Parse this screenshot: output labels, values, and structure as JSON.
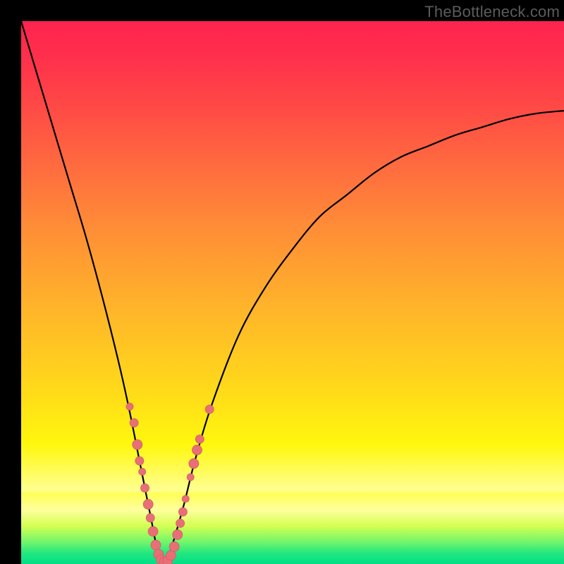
{
  "watermark": "TheBottleneck.com",
  "colors": {
    "background": "#000000",
    "curve": "#000000",
    "marker_fill": "#e96f77",
    "marker_stroke": "#cf5c66",
    "gradient_stops": [
      "#ff234f",
      "#ff2e4c",
      "#ff4746",
      "#ff6c3f",
      "#ff8a37",
      "#ffb22b",
      "#ffda1a",
      "#fff70d",
      "#ffff93",
      "#ffff56",
      "#ffff9e",
      "#d4ff52",
      "#70f56c",
      "#23e77f",
      "#00df86"
    ]
  },
  "chart_data": {
    "type": "line",
    "title": "",
    "xlabel": "",
    "ylabel": "",
    "xlim": [
      0,
      100
    ],
    "ylim": [
      0,
      100
    ],
    "note": "Axes are implicit. x≈component index (0–100), y≈bottleneck % (0 good / 100 bad). Curve has a sharp minimum near x≈26 where y≈0.",
    "series": [
      {
        "name": "bottleneck-curve",
        "x": [
          0,
          3,
          6,
          9,
          12,
          15,
          18,
          20,
          22,
          24,
          25,
          26,
          27,
          28,
          30,
          32,
          35,
          40,
          45,
          50,
          55,
          60,
          65,
          70,
          75,
          80,
          85,
          90,
          95,
          100
        ],
        "y": [
          100,
          90,
          80,
          70,
          60,
          49,
          37,
          28,
          18,
          8,
          3,
          0,
          1,
          4,
          11,
          19,
          29,
          42,
          51,
          58,
          64,
          68,
          72,
          75,
          77,
          79,
          80.5,
          82,
          83,
          83.5
        ]
      }
    ],
    "markers": {
      "name": "highlighted-points",
      "points": [
        {
          "x": 20.0,
          "y": 29,
          "r": 5
        },
        {
          "x": 20.8,
          "y": 26,
          "r": 6
        },
        {
          "x": 21.4,
          "y": 22,
          "r": 7
        },
        {
          "x": 21.8,
          "y": 19,
          "r": 6
        },
        {
          "x": 22.3,
          "y": 17,
          "r": 5
        },
        {
          "x": 22.8,
          "y": 14,
          "r": 6
        },
        {
          "x": 23.4,
          "y": 11,
          "r": 7
        },
        {
          "x": 23.8,
          "y": 8.5,
          "r": 6
        },
        {
          "x": 24.3,
          "y": 6,
          "r": 7
        },
        {
          "x": 24.8,
          "y": 3.5,
          "r": 7
        },
        {
          "x": 25.3,
          "y": 1.8,
          "r": 7
        },
        {
          "x": 25.8,
          "y": 0.8,
          "r": 7
        },
        {
          "x": 26.4,
          "y": 0.4,
          "r": 7
        },
        {
          "x": 27.0,
          "y": 0.6,
          "r": 7
        },
        {
          "x": 27.6,
          "y": 1.6,
          "r": 7
        },
        {
          "x": 28.2,
          "y": 3.2,
          "r": 7
        },
        {
          "x": 28.8,
          "y": 5.4,
          "r": 7
        },
        {
          "x": 29.3,
          "y": 7.5,
          "r": 6
        },
        {
          "x": 29.8,
          "y": 9.6,
          "r": 6
        },
        {
          "x": 30.3,
          "y": 12,
          "r": 5
        },
        {
          "x": 31.2,
          "y": 16,
          "r": 5
        },
        {
          "x": 31.8,
          "y": 18.5,
          "r": 7
        },
        {
          "x": 32.4,
          "y": 21,
          "r": 7
        },
        {
          "x": 32.9,
          "y": 23,
          "r": 6
        },
        {
          "x": 34.7,
          "y": 28.5,
          "r": 6
        }
      ]
    }
  }
}
